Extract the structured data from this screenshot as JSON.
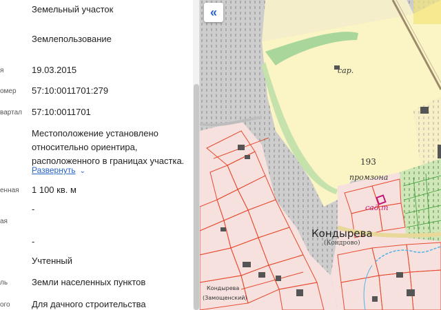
{
  "panel": {
    "rows": [
      {
        "label": "",
        "value": "Земельный участок"
      },
      {
        "label": "",
        "value": "Землепользование"
      },
      {
        "label": "я",
        "value": "19.03.2015"
      },
      {
        "label": "омер",
        "value": "57:10:0011701:279"
      },
      {
        "label": "вартал",
        "value": "57:10:0011701"
      },
      {
        "label": "",
        "value": "Местоположение установлено относительно ориентира, расположенного в границах участка."
      },
      {
        "label": "",
        "value": "Развернуть"
      },
      {
        "label": "енная",
        "value": "1 100 кв. м"
      },
      {
        "label": "",
        "value": "-"
      },
      {
        "label": "ая",
        "value": ""
      },
      {
        "label": "",
        "value": "-"
      },
      {
        "label": "",
        "value": "Учтенный"
      },
      {
        "label": "ль",
        "value": "Земли населенных пунктов"
      },
      {
        "label": "ого",
        "value": "Для дачного строительства"
      }
    ]
  },
  "map": {
    "collapse_icon": "«",
    "labels": {
      "sar": "сар.",
      "n193": "193",
      "promzona": "промзона",
      "sadg": "сад.т",
      "kondyreva": "Кондырева",
      "kondrovo": "(Кондрово)",
      "kondyreva_small": "Кондырева",
      "zamoshenskiy": "(Замощенский)"
    },
    "colors": {
      "field": "#fbf4c4",
      "forest": "#d2e6b6",
      "gray": "#cfcfcf",
      "parcel": "#e8492e",
      "water": "#4fb3e8",
      "highlight": "#c2187a"
    }
  }
}
